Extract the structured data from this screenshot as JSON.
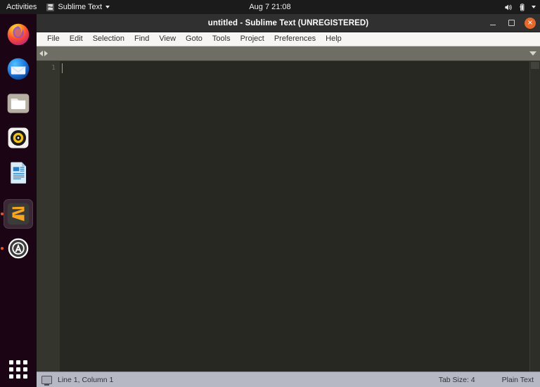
{
  "topbar": {
    "activities": "Activities",
    "app_name": "Sublime Text",
    "app_icon": "sublime-text-icon",
    "clock": "Aug 7  21:08",
    "tray": {
      "volume_icon": "volume-speaker-icon",
      "battery_icon": "battery-icon",
      "menu_icon": "chevron-down-icon"
    }
  },
  "dock": {
    "items": [
      {
        "name": "firefox",
        "label": "Firefox",
        "running": false,
        "active": false
      },
      {
        "name": "thunderbird",
        "label": "Thunderbird Mail",
        "running": false,
        "active": false
      },
      {
        "name": "files",
        "label": "Files",
        "running": false,
        "active": false
      },
      {
        "name": "rhythmbox",
        "label": "Rhythmbox",
        "running": false,
        "active": false
      },
      {
        "name": "libreoffice-writer",
        "label": "LibreOffice Writer",
        "running": false,
        "active": false
      },
      {
        "name": "sublime-text",
        "label": "Sublime Text",
        "running": true,
        "active": true
      },
      {
        "name": "ubuntu-software",
        "label": "Ubuntu Software",
        "running": true,
        "active": false
      }
    ],
    "show_apps_label": "Show Applications"
  },
  "window": {
    "title": "untitled - Sublime Text (UNREGISTERED)",
    "controls": {
      "minimize": "minimize-button",
      "maximize": "maximize-button",
      "close": "×"
    }
  },
  "menubar": {
    "items": [
      {
        "label": "File"
      },
      {
        "label": "Edit"
      },
      {
        "label": "Selection"
      },
      {
        "label": "Find"
      },
      {
        "label": "View"
      },
      {
        "label": "Goto"
      },
      {
        "label": "Tools"
      },
      {
        "label": "Project"
      },
      {
        "label": "Preferences"
      },
      {
        "label": "Help"
      }
    ]
  },
  "tabbar": {
    "scroll_left_icon": "chevron-left-icon",
    "scroll_right_icon": "chevron-right-icon",
    "tab_menu_icon": "chevron-down-icon",
    "tabs": []
  },
  "editor": {
    "line_numbers": [
      "1"
    ],
    "content": "",
    "caret_line": 1,
    "caret_column": 1
  },
  "statusbar": {
    "encoding_icon": "monitor-icon",
    "position": "Line 1, Column 1",
    "tab_size": "Tab Size: 4",
    "syntax": "Plain Text"
  },
  "colors": {
    "accent": "#e95420",
    "editor_bg": "#272822",
    "gutter_bg": "#34352c",
    "tabbar_bg": "#6e6e64",
    "statusbar_bg": "#b6b9c4",
    "titlebar_bg": "#303030",
    "menubar_bg": "#f6f5f4",
    "topbar_bg": "#1b1b1b",
    "dock_bg": "#170612"
  }
}
